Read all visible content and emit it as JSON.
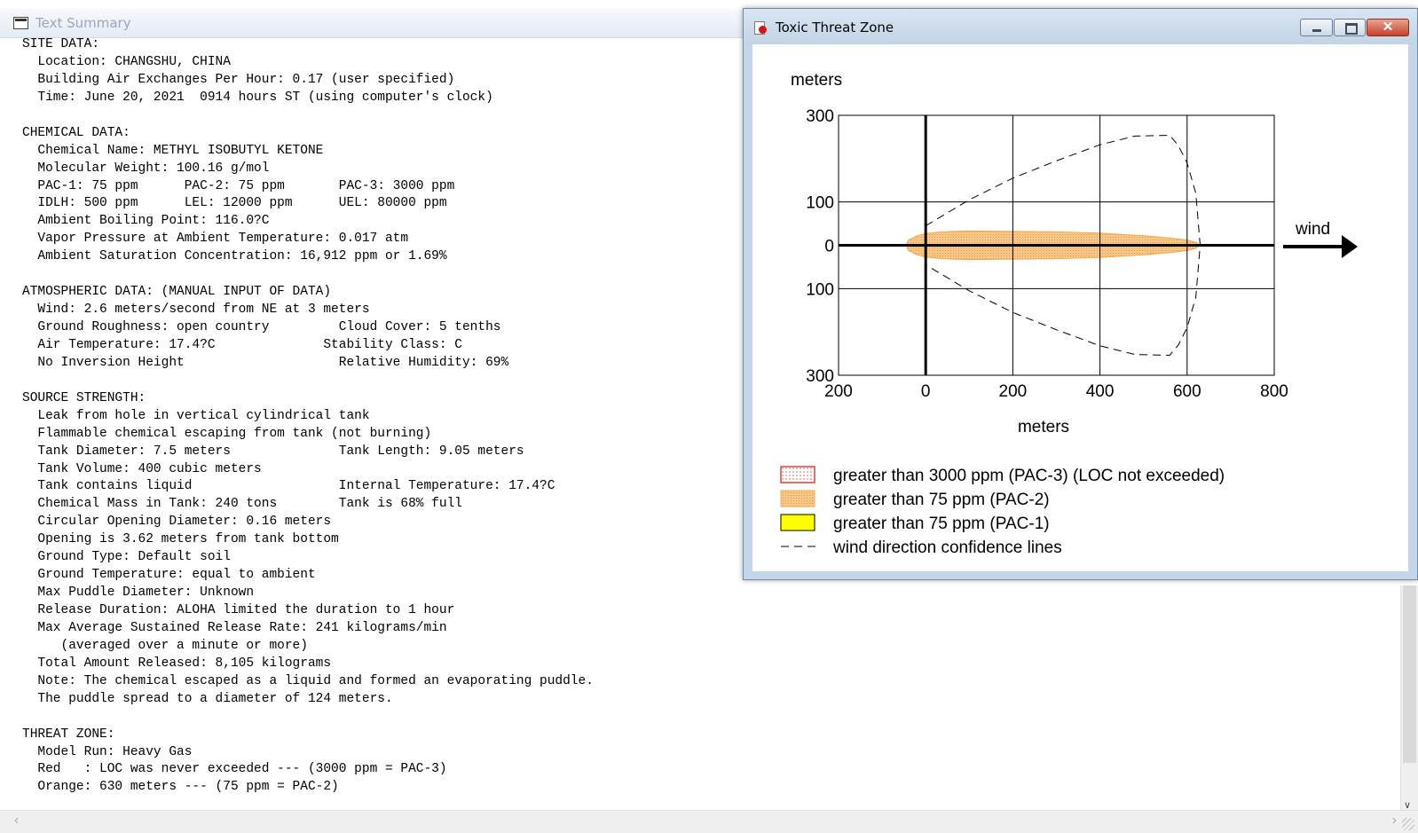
{
  "text_summary": {
    "title": "Text Summary",
    "lines": [
      "SITE DATA:",
      "  Location: CHANGSHU, CHINA",
      "  Building Air Exchanges Per Hour: 0.17 (user specified)",
      "  Time: June 20, 2021  0914 hours ST (using computer's clock)",
      "",
      "CHEMICAL DATA:",
      "  Chemical Name: METHYL ISOBUTYL KETONE",
      "  Molecular Weight: 100.16 g/mol",
      "  PAC-1: 75 ppm      PAC-2: 75 ppm       PAC-3: 3000 ppm",
      "  IDLH: 500 ppm      LEL: 12000 ppm      UEL: 80000 ppm",
      "  Ambient Boiling Point: 116.0?C",
      "  Vapor Pressure at Ambient Temperature: 0.017 atm",
      "  Ambient Saturation Concentration: 16,912 ppm or 1.69%",
      "",
      "ATMOSPHERIC DATA: (MANUAL INPUT OF DATA)",
      "  Wind: 2.6 meters/second from NE at 3 meters",
      "  Ground Roughness: open country         Cloud Cover: 5 tenths",
      "  Air Temperature: 17.4?C              Stability Class: C",
      "  No Inversion Height                    Relative Humidity: 69%",
      "",
      "SOURCE STRENGTH:",
      "  Leak from hole in vertical cylindrical tank",
      "  Flammable chemical escaping from tank (not burning)",
      "  Tank Diameter: 7.5 meters              Tank Length: 9.05 meters",
      "  Tank Volume: 400 cubic meters",
      "  Tank contains liquid                   Internal Temperature: 17.4?C",
      "  Chemical Mass in Tank: 240 tons        Tank is 68% full",
      "  Circular Opening Diameter: 0.16 meters",
      "  Opening is 3.62 meters from tank bottom",
      "  Ground Type: Default soil",
      "  Ground Temperature: equal to ambient",
      "  Max Puddle Diameter: Unknown",
      "  Release Duration: ALOHA limited the duration to 1 hour",
      "  Max Average Sustained Release Rate: 241 kilograms/min",
      "     (averaged over a minute or more)",
      "  Total Amount Released: 8,105 kilograms",
      "  Note: The chemical escaped as a liquid and formed an evaporating puddle.",
      "  The puddle spread to a diameter of 124 meters.",
      "",
      "THREAT ZONE:",
      "  Model Run: Heavy Gas",
      "  Red   : LOC was never exceeded --- (3000 ppm = PAC-3)",
      "  Orange: 630 meters --- (75 ppm = PAC-2)"
    ]
  },
  "threat_zone": {
    "title": "Toxic Threat Zone",
    "close_glyph": "✕",
    "wind_label": "wind",
    "legend": [
      {
        "label": "greater than 3000 ppm (PAC-3) (LOC not exceeded)",
        "swatch": "dotted-red",
        "color": "#e04040"
      },
      {
        "label": "greater than 75 ppm (PAC-2)",
        "swatch": "orange",
        "color": "#f9c78a"
      },
      {
        "label": "greater than 75 ppm (PAC-1)",
        "swatch": "yellow",
        "color": "#ffff00"
      },
      {
        "label": "wind direction confidence lines",
        "swatch": "dashed",
        "color": "#000000"
      }
    ]
  },
  "chart_data": {
    "type": "area",
    "xlabel": "meters",
    "ylabel": "meters",
    "xlim": [
      -200,
      800
    ],
    "ylim": [
      -300,
      300
    ],
    "x_ticks": [
      -200,
      0,
      200,
      400,
      600,
      800
    ],
    "x_tick_labels": [
      "200",
      "0",
      "200",
      "400",
      "600",
      "800"
    ],
    "y_ticks": [
      300,
      100,
      0,
      -100,
      -300
    ],
    "y_tick_labels": [
      "300",
      "100",
      "0",
      "100",
      "300"
    ],
    "grid": true,
    "zones": [
      {
        "name": "greater than 75 ppm (PAC-2)",
        "color": "#f9c78a",
        "x": [
          -45,
          -40,
          -20,
          0,
          30,
          60,
          100,
          200,
          300,
          400,
          500,
          560,
          600,
          620,
          630
        ],
        "y_half": [
          0,
          12,
          22,
          27,
          30,
          32,
          33,
          32,
          31,
          28,
          22,
          17,
          12,
          7,
          0
        ]
      }
    ],
    "confidence_lines": {
      "x": [
        0,
        100,
        200,
        300,
        400,
        480,
        560,
        580,
        600,
        620,
        630
      ],
      "y_half": [
        45,
        105,
        155,
        195,
        232,
        252,
        254,
        230,
        190,
        120,
        0
      ]
    }
  }
}
